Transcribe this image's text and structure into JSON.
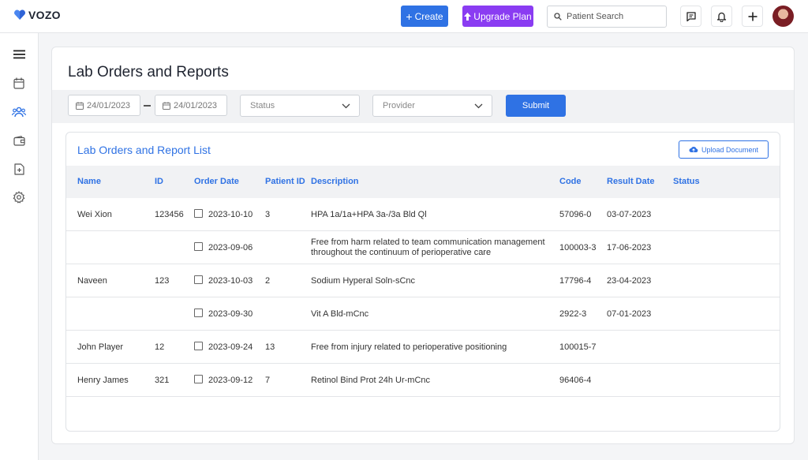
{
  "app": {
    "logo_text": "VOZO",
    "brand_color": "#2f72e4",
    "upgrade_color": "#8a3cf2"
  },
  "header": {
    "create_label": "Create",
    "upgrade_label": "Upgrade Plan",
    "search_placeholder": "Patient Search",
    "icons": [
      "message-icon",
      "bell-icon",
      "plus-icon",
      "user-avatar"
    ]
  },
  "sidebar": {
    "icons": [
      "menu-icon",
      "calendar-icon",
      "users-icon",
      "wallet-icon",
      "document-plus-icon",
      "gear-icon"
    ]
  },
  "page": {
    "title": "Lab Orders and Reports"
  },
  "filters": {
    "date_from": "24/01/2023",
    "date_to": "24/01/2023",
    "status_placeholder": "Status",
    "provider_placeholder": "Provider",
    "submit_label": "Submit"
  },
  "list": {
    "title": "Lab Orders and Report List",
    "upload_label": "Upload Document",
    "columns": [
      "Name",
      "ID",
      "Order Date",
      "Patient ID",
      "Description",
      "Code",
      "Result Date",
      "Status"
    ],
    "rows": [
      {
        "name": "Wei Xion",
        "id": "123456",
        "order_date": "2023-10-10",
        "patient_id": "3",
        "description": "HPA 1a/1a+HPA 3a-/3a Bld Ql",
        "description2": "",
        "code": "57096-0",
        "result_date": "03-07-2023",
        "status": ""
      },
      {
        "name": "",
        "id": "",
        "order_date": "2023-09-06",
        "patient_id": "",
        "description": "Free from harm related to team communication management",
        "description2": "throughout the continuum of perioperative care",
        "code": "100003-3",
        "result_date": "17-06-2023",
        "status": ""
      },
      {
        "name": "Naveen",
        "id": "123",
        "order_date": "2023-10-03",
        "patient_id": "2",
        "description": "Sodium Hyperal Soln-sCnc",
        "description2": "",
        "code": "17796-4",
        "result_date": "23-04-2023",
        "status": ""
      },
      {
        "name": "",
        "id": "",
        "order_date": "2023-09-30",
        "patient_id": "",
        "description": "Vit A Bld-mCnc",
        "description2": "",
        "code": "2922-3",
        "result_date": "07-01-2023",
        "status": ""
      },
      {
        "name": "John Player",
        "id": "12",
        "order_date": "2023-09-24",
        "patient_id": "13",
        "description": "Free from injury related to perioperative positioning",
        "description2": "",
        "code": "100015-7",
        "result_date": "",
        "status": ""
      },
      {
        "name": "Henry James",
        "id": "321",
        "order_date": "2023-09-12",
        "patient_id": "7",
        "description": "Retinol Bind Prot 24h Ur-mCnc",
        "description2": "",
        "code": "96406-4",
        "result_date": "",
        "status": ""
      }
    ]
  }
}
